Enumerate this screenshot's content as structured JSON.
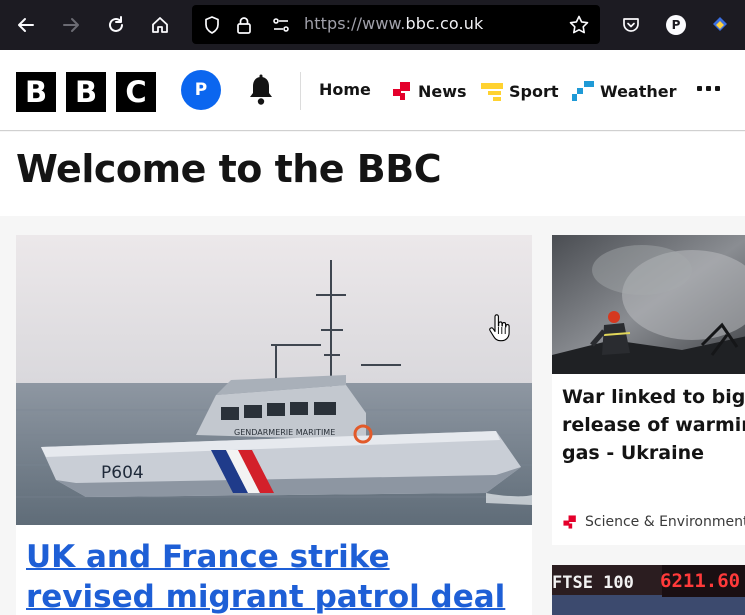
{
  "browser": {
    "url_prefix": "https://www.",
    "url_domain": "bbc.co.uk",
    "profile_initial": "P"
  },
  "header": {
    "logo_letters": [
      "B",
      "B",
      "C"
    ],
    "account_initial": "P",
    "nav": [
      {
        "label": "Home"
      },
      {
        "label": "News",
        "accent": "#e4002b"
      },
      {
        "label": "Sport",
        "accent": "#ffd230"
      },
      {
        "label": "Weather",
        "accent": "#1f9ad6"
      }
    ]
  },
  "welcome": {
    "title": "Welcome to the BBC"
  },
  "main_story": {
    "headline": "UK and France strike revised migrant patrol deal",
    "image_label_boat": "P604",
    "image_label_side": "GENDARMERIE MARITIME"
  },
  "side_story": {
    "headline_lines": [
      "War linked to big",
      "release of warming",
      "gas - Ukraine"
    ],
    "topic": "Science & Environment"
  },
  "ticker_story": {
    "label": "FTSE 100",
    "value": "6211.60"
  },
  "colors": {
    "link": "#1e5fd6",
    "news_red": "#e4002b",
    "sport_yellow": "#ffd230",
    "weather_blue": "#1f9ad6",
    "avatar_blue": "#0b66ef"
  }
}
